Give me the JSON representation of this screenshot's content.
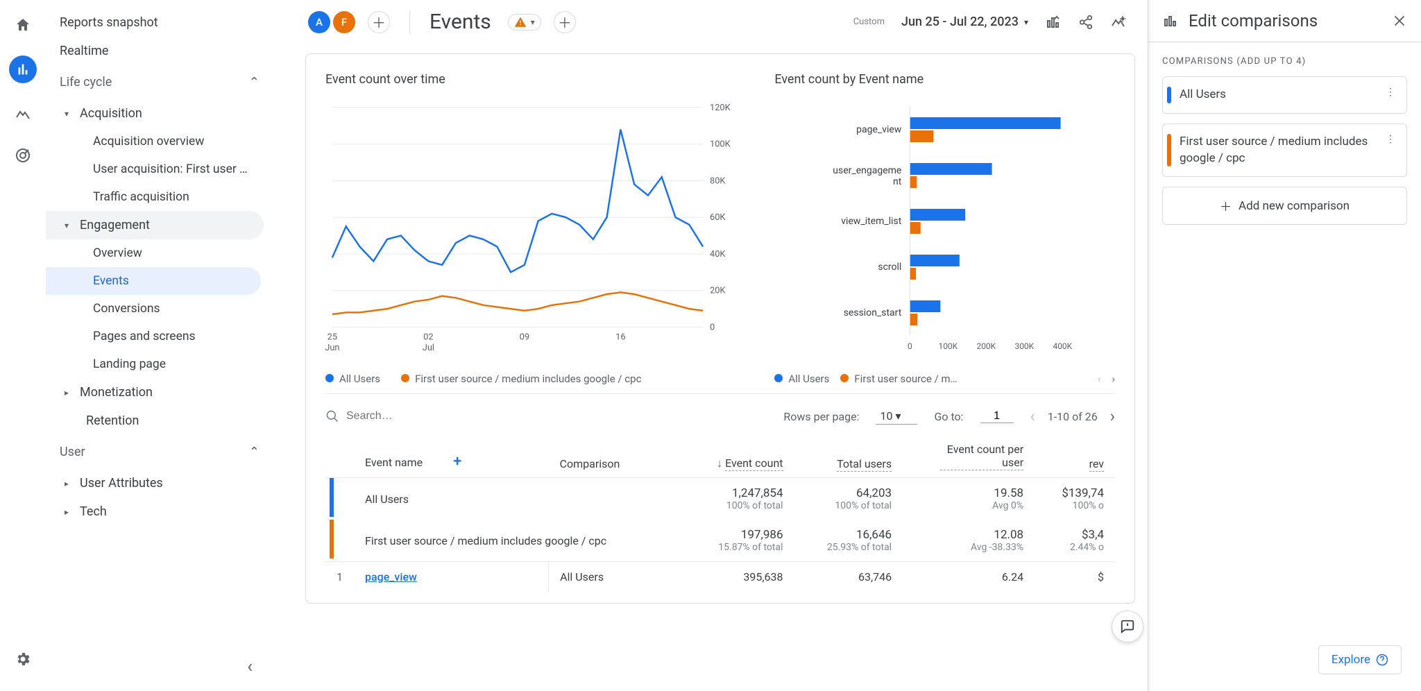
{
  "colors": {
    "blue": "#1a73e8",
    "orange": "#e8710a"
  },
  "nav": {
    "reports_snapshot": "Reports snapshot",
    "realtime": "Realtime",
    "life_cycle": "Life cycle",
    "acquisition": "Acquisition",
    "acquisition_overview": "Acquisition overview",
    "user_acquisition": "User acquisition: First user …",
    "traffic_acquisition": "Traffic acquisition",
    "engagement": "Engagement",
    "overview": "Overview",
    "events": "Events",
    "conversions": "Conversions",
    "pages_screens": "Pages and screens",
    "landing_page": "Landing page",
    "monetization": "Monetization",
    "retention": "Retention",
    "user": "User",
    "user_attributes": "User Attributes",
    "tech": "Tech"
  },
  "header": {
    "chip_a": "A",
    "chip_f": "F",
    "title": "Events",
    "custom_label": "Custom",
    "date_range": "Jun 25 - Jul 22, 2023"
  },
  "charts": {
    "time_title": "Event count over time",
    "bar_title": "Event count by Event name",
    "legend_all": "All Users",
    "legend_cpc": "First user source / medium includes google / cpc",
    "legend_cpc_trunc": "First user source / m…"
  },
  "chart_data": {
    "time_series": {
      "type": "line",
      "ylim": [
        0,
        120000
      ],
      "yticks": [
        0,
        20000,
        40000,
        60000,
        80000,
        100000,
        120000
      ],
      "ytick_labels": [
        "0",
        "20K",
        "40K",
        "60K",
        "80K",
        "100K",
        "120K"
      ],
      "x_labels": [
        "25\nJun",
        "02\nJul",
        "09",
        "16"
      ],
      "x_count": 28,
      "series": [
        {
          "name": "All Users",
          "color": "#1a73e8",
          "values": [
            38000,
            55000,
            44000,
            36000,
            48000,
            50000,
            42000,
            36000,
            34000,
            46000,
            50000,
            48000,
            44000,
            30000,
            34000,
            58000,
            62000,
            60000,
            56000,
            48000,
            60000,
            108000,
            78000,
            72000,
            82000,
            60000,
            56000,
            44000
          ]
        },
        {
          "name": "First user source / medium includes google / cpc",
          "color": "#e8710a",
          "values": [
            7000,
            8000,
            8000,
            9000,
            10000,
            12000,
            14000,
            15000,
            17000,
            16000,
            14000,
            12000,
            11000,
            10000,
            9000,
            10000,
            12000,
            13000,
            14000,
            16000,
            18000,
            19000,
            18000,
            16000,
            14000,
            12000,
            10000,
            9000
          ]
        }
      ]
    },
    "bar_chart": {
      "type": "bar",
      "xlim": [
        0,
        400000
      ],
      "xticks": [
        0,
        100000,
        200000,
        300000,
        400000
      ],
      "xtick_labels": [
        "0",
        "100K",
        "200K",
        "300K",
        "400K"
      ],
      "categories": [
        "page_view",
        "user_engagement",
        "view_item_list",
        "scroll",
        "session_start"
      ],
      "category_labels": [
        "page_view",
        "user_engageme\nnt",
        "view_item_list",
        "scroll",
        "session_start"
      ],
      "series": [
        {
          "name": "All Users",
          "color": "#1a73e8",
          "values": [
            395000,
            215000,
            145000,
            130000,
            80000
          ]
        },
        {
          "name": "First user source / medium includes google / cpc",
          "color": "#e8710a",
          "values": [
            62000,
            18000,
            28000,
            16000,
            20000
          ]
        }
      ]
    }
  },
  "table": {
    "search_placeholder": "Search…",
    "rows_label": "Rows per page:",
    "rows_value": "10",
    "goto_label": "Go to:",
    "goto_value": "1",
    "range_label": "1-10 of 26",
    "headers": {
      "event_name": "Event name",
      "comparison": "Comparison",
      "event_count": "Event count",
      "total_users": "Total users",
      "count_per_user": "Event count per user",
      "revenue_trunc": "rev"
    },
    "summary": [
      {
        "label": "All Users",
        "color": "#1a73e8",
        "event_count": "1,247,854",
        "event_count_sub": "100% of total",
        "total_users": "64,203",
        "total_users_sub": "100% of total",
        "per_user": "19.58",
        "per_user_sub": "Avg 0%",
        "rev": "$139,74",
        "rev_sub": "100% o"
      },
      {
        "label": "First user source / medium includes google / cpc",
        "color": "#e8710a",
        "event_count": "197,986",
        "event_count_sub": "15.87% of total",
        "total_users": "16,646",
        "total_users_sub": "25.93% of total",
        "per_user": "12.08",
        "per_user_sub": "Avg -38.33%",
        "rev": "$3,4",
        "rev_sub": "2.44% o"
      }
    ],
    "rows": [
      {
        "idx": "1",
        "name": "page_view",
        "cmp": "All Users",
        "event_count": "395,638",
        "total_users": "63,746",
        "per_user": "6.24",
        "rev": "$"
      }
    ]
  },
  "sidepanel": {
    "title": "Edit comparisons",
    "section_label": "Comparisons (add up to 4)",
    "items": [
      {
        "color": "#1a73e8",
        "text": "All Users"
      },
      {
        "color": "#e8710a",
        "text": "First user source / medium includes google / cpc"
      }
    ],
    "add_label": "Add new comparison"
  },
  "explore_label": "Explore"
}
